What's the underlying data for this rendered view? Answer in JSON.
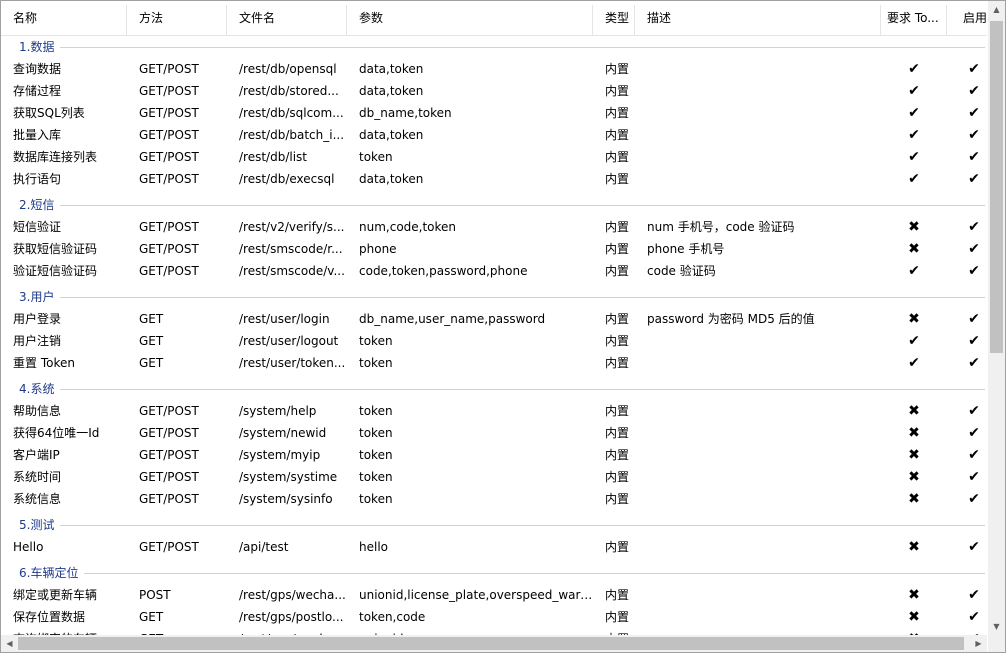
{
  "columns": [
    "名称",
    "方法",
    "文件名",
    "参数",
    "类型",
    "描述",
    "要求 To...",
    "启用"
  ],
  "check_glyph": "✔",
  "cross_glyph": "✖",
  "groups": [
    {
      "title": "1.数据",
      "rows": [
        {
          "name": "查询数据",
          "method": "GET/POST",
          "file": "/rest/db/opensql",
          "params": "data,token",
          "type": "内置",
          "desc": "",
          "token": true,
          "enabled": true
        },
        {
          "name": "存储过程",
          "method": "GET/POST",
          "file": "/rest/db/stored...",
          "params": "data,token",
          "type": "内置",
          "desc": "",
          "token": true,
          "enabled": true
        },
        {
          "name": "获取SQL列表",
          "method": "GET/POST",
          "file": "/rest/db/sqlcom...",
          "params": "db_name,token",
          "type": "内置",
          "desc": "",
          "token": true,
          "enabled": true
        },
        {
          "name": "批量入库",
          "method": "GET/POST",
          "file": "/rest/db/batch_i...",
          "params": "data,token",
          "type": "内置",
          "desc": "",
          "token": true,
          "enabled": true
        },
        {
          "name": "数据库连接列表",
          "method": "GET/POST",
          "file": "/rest/db/list",
          "params": "token",
          "type": "内置",
          "desc": "",
          "token": true,
          "enabled": true
        },
        {
          "name": "执行语句",
          "method": "GET/POST",
          "file": "/rest/db/execsql",
          "params": "data,token",
          "type": "内置",
          "desc": "",
          "token": true,
          "enabled": true
        }
      ]
    },
    {
      "title": "2.短信",
      "rows": [
        {
          "name": "短信验证",
          "method": "GET/POST",
          "file": "/rest/v2/verify/s...",
          "params": "num,code,token",
          "type": "内置",
          "desc": "num 手机号，code 验证码",
          "token": false,
          "enabled": true
        },
        {
          "name": "获取短信验证码",
          "method": "GET/POST",
          "file": "/rest/smscode/r...",
          "params": "phone",
          "type": "内置",
          "desc": "phone 手机号",
          "token": false,
          "enabled": true
        },
        {
          "name": "验证短信验证码",
          "method": "GET/POST",
          "file": "/rest/smscode/v...",
          "params": "code,token,password,phone",
          "type": "内置",
          "desc": "code 验证码",
          "token": true,
          "enabled": true
        }
      ]
    },
    {
      "title": "3.用户",
      "rows": [
        {
          "name": "用户登录",
          "method": "GET",
          "file": "/rest/user/login",
          "params": "db_name,user_name,password",
          "type": "内置",
          "desc": "password 为密码 MD5 后的值",
          "token": false,
          "enabled": true
        },
        {
          "name": "用户注销",
          "method": "GET",
          "file": "/rest/user/logout",
          "params": "token",
          "type": "内置",
          "desc": "",
          "token": true,
          "enabled": true
        },
        {
          "name": "重置 Token",
          "method": "GET",
          "file": "/rest/user/token...",
          "params": "token",
          "type": "内置",
          "desc": "",
          "token": true,
          "enabled": true
        }
      ]
    },
    {
      "title": "4.系统",
      "rows": [
        {
          "name": "帮助信息",
          "method": "GET/POST",
          "file": "/system/help",
          "params": "token",
          "type": "内置",
          "desc": "",
          "token": false,
          "enabled": true
        },
        {
          "name": "获得64位唯一Id",
          "method": "GET/POST",
          "file": "/system/newid",
          "params": "token",
          "type": "内置",
          "desc": "",
          "token": false,
          "enabled": true
        },
        {
          "name": "客户端IP",
          "method": "GET/POST",
          "file": "/system/myip",
          "params": "token",
          "type": "内置",
          "desc": "",
          "token": false,
          "enabled": true
        },
        {
          "name": "系统时间",
          "method": "GET/POST",
          "file": "/system/systime",
          "params": "token",
          "type": "内置",
          "desc": "",
          "token": false,
          "enabled": true
        },
        {
          "name": "系统信息",
          "method": "GET/POST",
          "file": "/system/sysinfo",
          "params": "token",
          "type": "内置",
          "desc": "",
          "token": false,
          "enabled": true
        }
      ]
    },
    {
      "title": "5.测试",
      "rows": [
        {
          "name": "Hello",
          "method": "GET/POST",
          "file": "/api/test",
          "params": "hello",
          "type": "内置",
          "desc": "",
          "token": false,
          "enabled": true
        }
      ]
    },
    {
      "title": "6.车辆定位",
      "rows": [
        {
          "name": "绑定或更新车辆",
          "method": "POST",
          "file": "/rest/gps/wecha...",
          "params": "unionid,license_plate,overspeed_warni...",
          "type": "内置",
          "desc": "",
          "token": false,
          "enabled": true
        },
        {
          "name": "保存位置数据",
          "method": "GET",
          "file": "/rest/gps/postlo...",
          "params": "token,code",
          "type": "内置",
          "desc": "",
          "token": false,
          "enabled": true
        },
        {
          "name": "查询绑定的车辆",
          "method": "GET",
          "file": "/rest/gps/wecha...",
          "params": "unionid",
          "type": "内置",
          "desc": "",
          "token": false,
          "enabled": true
        }
      ]
    }
  ]
}
